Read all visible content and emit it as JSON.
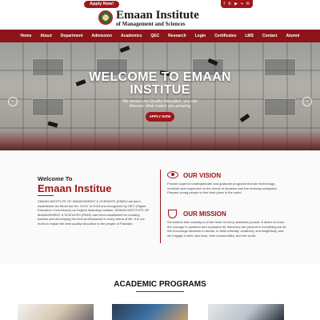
{
  "topbar": {
    "apply_label": "Apply Now!",
    "social_icons": [
      "facebook-icon",
      "phone-icon",
      "youtube-icon",
      "location-icon",
      "email-icon"
    ]
  },
  "header": {
    "brand_name": "Emaan Institute",
    "brand_subtitle": "of Management and Sciences"
  },
  "nav": {
    "items": [
      "Home",
      "About",
      "Department",
      "Admission",
      "Academics",
      "QEC",
      "Research",
      "Login",
      "Certificates",
      "LMS",
      "Contact",
      "Alumni"
    ]
  },
  "hero": {
    "title_line1": "WELCOME TO EMAAN",
    "title_line2": "INSTITUE",
    "subtitle_line1": "We serves you Quality Education, you can",
    "subtitle_line2": "discover what makes you amazing",
    "apply_label": "APPLY NOW"
  },
  "welcome": {
    "heading": "Welcome To",
    "name": "Emaan Institue",
    "body": "EMAAN INSTITUTE OF MANAGEMENT & SCIENCES (EIMS) has been established via Sindh Act No. XXXV of 2018 and recognized by HEC (Higher Education Commission) as Degree Awarding Institute. EMAAN INSTITUTE OF MANAGEMENT & SCIENCES (EIMS) has been established for creating leaders and developing the best professionals in every arena of life. It is our motto to impart the best quality education to the people of Pakistan."
  },
  "vision": {
    "title": "OUR VISION",
    "text": "Provide superior undergraduate and graduate programs that are technology-enriched and responsive to the needs of students and the evolving workplace. Prepare young people to find their place in the world."
  },
  "mission": {
    "title": "OUR MISSION",
    "text": "We believe that curiosity is at the heart of every academic pursuit. A desire to learn, the courage to question and a passion for discovery are present in everything we do. We encourage students to dream, to think critically, creatively, and insightfully, and we engage in their own lives, their communities, and the world."
  },
  "programs": {
    "title": "ACADEMIC PROGRAMS"
  },
  "colors": {
    "brand_red": "#a0161b",
    "nav_red": "#8c1419"
  }
}
